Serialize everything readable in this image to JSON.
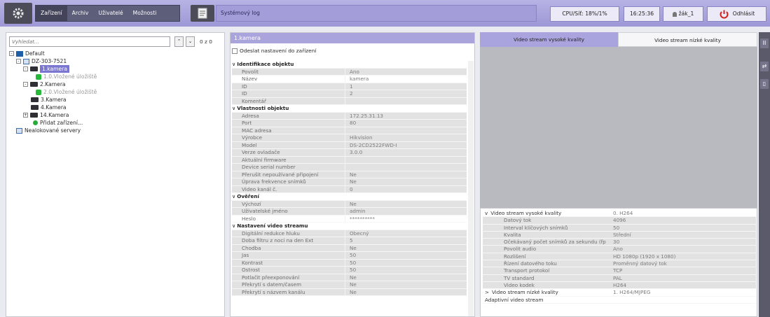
{
  "topbar": {
    "tabs": [
      "Zařízení",
      "Archiv",
      "Uživatelé",
      "Možnosti"
    ],
    "active_tab": "Zařízení",
    "log_tab": "Systémový log",
    "cpu": "CPU/Síť: 18%/1%",
    "time": "16:25:36",
    "user": "žák_1",
    "logout": "Odhlásit"
  },
  "tree": {
    "search_placeholder": "Vyhledat...",
    "counter": "0 z 0",
    "up": "^",
    "down": "v",
    "items": [
      {
        "label": "Default",
        "expander": "-"
      },
      {
        "label": "DZ-303-7521",
        "expander": "-"
      },
      {
        "label": "1.kamera",
        "expander": "-"
      },
      {
        "label": "1.0.Vložené úložiště",
        "expander": ""
      },
      {
        "label": "2.Kamera",
        "expander": "-"
      },
      {
        "label": "2.0.Vložené úložiště",
        "expander": ""
      },
      {
        "label": "3.Kamera",
        "expander": ""
      },
      {
        "label": "4.Kamera",
        "expander": ""
      },
      {
        "label": "14.Kamera",
        "expander": "+"
      },
      {
        "label": "Přidat zařízení...",
        "expander": ""
      },
      {
        "label": "Nealokované servery",
        "expander": ""
      }
    ]
  },
  "props": {
    "header": "1.kamera",
    "send_checkbox": "Odeslat nastavení do zařízení",
    "rows": [
      {
        "k": "Identifikace objektu",
        "v": "",
        "sec": true
      },
      {
        "k": "Povolit",
        "v": "Ano"
      },
      {
        "k": "Název",
        "v": "kamera",
        "white": true
      },
      {
        "k": "ID",
        "v": "1"
      },
      {
        "k": "ID",
        "v": "2"
      },
      {
        "k": "Komentář",
        "v": ""
      },
      {
        "k": "Vlastnosti objektu",
        "v": "",
        "sec": true
      },
      {
        "k": "Adresa",
        "v": "172.25.31.13"
      },
      {
        "k": "Port",
        "v": "80"
      },
      {
        "k": "MAC adresa",
        "v": ""
      },
      {
        "k": "Výrobce",
        "v": "Hikvision"
      },
      {
        "k": "Model",
        "v": "DS-2CD2522FWD-I"
      },
      {
        "k": "Verze ovladače",
        "v": "3.0.0"
      },
      {
        "k": "Aktuální firmware",
        "v": ""
      },
      {
        "k": "Device serial number",
        "v": ""
      },
      {
        "k": "Přerušit nepoužívané připojení",
        "v": "Ne"
      },
      {
        "k": "Úprava frekvence snímků",
        "v": "Ne"
      },
      {
        "k": "Video kanál č.",
        "v": "0"
      },
      {
        "k": "Ověření",
        "v": "",
        "sec": true
      },
      {
        "k": "Výchozí",
        "v": "Ne"
      },
      {
        "k": "Uživatelské jméno",
        "v": "admin"
      },
      {
        "k": "Heslo",
        "v": "**********",
        "white": true
      },
      {
        "k": "Nastavení video streamu",
        "v": "",
        "sec": true
      },
      {
        "k": "Digitální redukce hluku",
        "v": "Obecný"
      },
      {
        "k": "Doba filtru z noci na den Ext",
        "v": "5"
      },
      {
        "k": "Chodba",
        "v": "Ne"
      },
      {
        "k": "Jas",
        "v": "50"
      },
      {
        "k": "Kontrast",
        "v": "50"
      },
      {
        "k": "Ostrost",
        "v": "50"
      },
      {
        "k": "Potlačit přeexponování",
        "v": "Ne"
      },
      {
        "k": "Překrytí s datem/časem",
        "v": "Ne"
      },
      {
        "k": "Překrytí s názvem kanálu",
        "v": "Ne"
      }
    ]
  },
  "video": {
    "tab_high": "Video stream vysoké kvality",
    "tab_low": "Video stream nízké kvality",
    "rows": [
      {
        "k": "Video stream vysoké kvality",
        "v": "0. H264",
        "top": true,
        "arrow": "v"
      },
      {
        "k": "Datový tok",
        "v": "4096"
      },
      {
        "k": "Interval klíčových snímků",
        "v": "50"
      },
      {
        "k": "Kvalita",
        "v": "Střední"
      },
      {
        "k": "Očekávaný počet snímků za sekundu (fp",
        "v": "30"
      },
      {
        "k": "Povolit audio",
        "v": "Ano"
      },
      {
        "k": "Rozlišení",
        "v": "HD 1080p (1920 x 1080)"
      },
      {
        "k": "Řízení datového toku",
        "v": "Proměnný datový tok"
      },
      {
        "k": "Transport protokol",
        "v": "TCP"
      },
      {
        "k": "TV standard",
        "v": "PAL"
      },
      {
        "k": "Video kodek",
        "v": "H264"
      },
      {
        "k": "Video stream nízké kvality",
        "v": "1. H264/MJPEG",
        "top": true,
        "arrow": ">"
      },
      {
        "k": "Adaptivní video stream",
        "v": "",
        "top": true,
        "arrow": ""
      }
    ]
  },
  "side": {
    "pause": "II",
    "tool": "⇄",
    "panel": "▯"
  }
}
